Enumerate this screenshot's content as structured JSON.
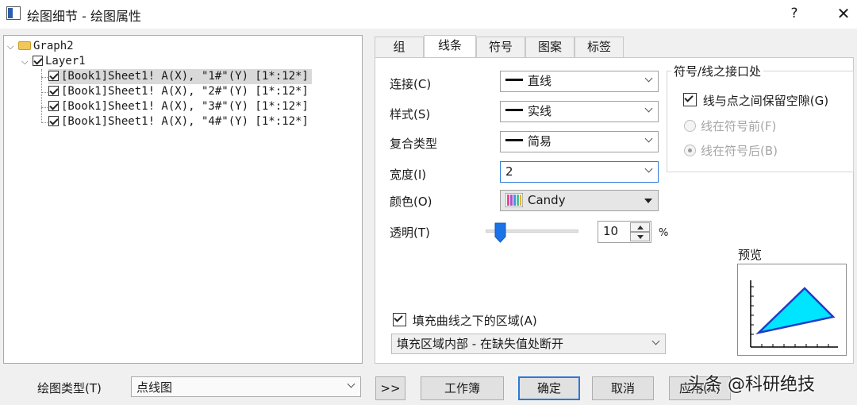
{
  "window": {
    "title": "绘图细节 - 绘图属性",
    "help_label": "?",
    "close_label": "✕"
  },
  "tree": {
    "root": "Graph2",
    "layer": "Layer1",
    "items": [
      {
        "label": "[Book1]Sheet1! A(X), \"1#\"(Y) [1*:12*]",
        "checked": true,
        "selected": true
      },
      {
        "label": "[Book1]Sheet1! A(X), \"2#\"(Y) [1*:12*]",
        "checked": true,
        "selected": false
      },
      {
        "label": "[Book1]Sheet1! A(X), \"3#\"(Y) [1*:12*]",
        "checked": true,
        "selected": false
      },
      {
        "label": "[Book1]Sheet1! A(X), \"4#\"(Y) [1*:12*]",
        "checked": true,
        "selected": false
      }
    ]
  },
  "tabs": [
    "组",
    "线条",
    "符号",
    "图案",
    "标签"
  ],
  "active_tab": "线条",
  "line": {
    "connect_label": "连接(C)",
    "connect_value": "直线",
    "style_label": "样式(S)",
    "style_value": "实线",
    "compound_label": "复合类型",
    "compound_value": "简易",
    "width_label": "宽度(I)",
    "width_value": "2",
    "color_label": "颜色(O)",
    "color_value": "Candy",
    "transparency_label": "透明(T)",
    "transparency_value": "10",
    "transparency_unit": "%",
    "transparency_fraction": 0.1
  },
  "gap_group": {
    "title": "符号/线之接口处",
    "gap_checkbox": "线与点之间保留空隙(G)",
    "gap_checked": true,
    "radio_before": "线在符号前(F)",
    "radio_after": "线在符号后(B)",
    "selected_radio": "after"
  },
  "preview": {
    "label": "预览",
    "fill_color": "#00e5ff",
    "line_color": "#1f3cc9"
  },
  "fill": {
    "checkbox": "填充曲线之下的区域(A)",
    "checked": true,
    "mode_value": "填充区域内部 - 在缺失值处断开"
  },
  "bottom": {
    "plot_type_label": "绘图类型(T)",
    "plot_type_value": "点线图",
    "expand_label": ">>",
    "workbook_label": "工作簿",
    "ok_label": "确定",
    "cancel_label": "取消",
    "apply_label": "应用(A)"
  },
  "watermark": "头条 @科研绝技"
}
